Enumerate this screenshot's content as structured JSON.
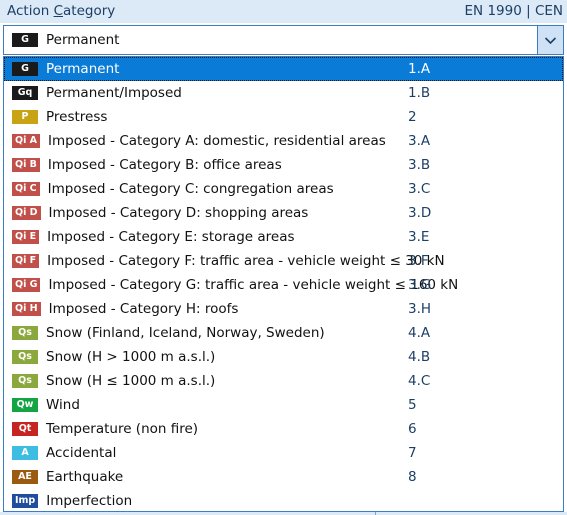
{
  "header": {
    "title_prefix": "Action ",
    "title_accel": "C",
    "title_suffix": "ategory",
    "standard": "EN 1990 | CEN"
  },
  "combo": {
    "selected_label": "Permanent",
    "selected_badge": "G",
    "selected_badge_color": "#1a1a1a",
    "arrow_icon": "chevron-down-icon"
  },
  "dropdown": {
    "options": [
      {
        "badge": "G",
        "badge_sub": "",
        "badge_color": "#1a1a1a",
        "label": "Permanent",
        "code": "1.A",
        "selected": true
      },
      {
        "badge": "G",
        "badge_sub": "q",
        "badge_color": "#1a1a1a",
        "label": "Permanent/Imposed",
        "code": "1.B",
        "selected": false
      },
      {
        "badge": "P",
        "badge_sub": "",
        "badge_color": "#c8a415",
        "label": "Prestress",
        "code": "2",
        "selected": false
      },
      {
        "badge": "Qi",
        "badge_sub": " A",
        "badge_color": "#c1504a",
        "label": "Imposed - Category A: domestic, residential areas",
        "code": "3.A",
        "selected": false
      },
      {
        "badge": "Qi",
        "badge_sub": " B",
        "badge_color": "#c1504a",
        "label": "Imposed - Category B: office areas",
        "code": "3.B",
        "selected": false
      },
      {
        "badge": "Qi",
        "badge_sub": " C",
        "badge_color": "#c1504a",
        "label": "Imposed - Category C: congregation areas",
        "code": "3.C",
        "selected": false
      },
      {
        "badge": "Qi",
        "badge_sub": " D",
        "badge_color": "#c1504a",
        "label": "Imposed - Category D: shopping areas",
        "code": "3.D",
        "selected": false
      },
      {
        "badge": "Qi",
        "badge_sub": " E",
        "badge_color": "#c1504a",
        "label": "Imposed - Category E: storage areas",
        "code": "3.E",
        "selected": false
      },
      {
        "badge": "Qi",
        "badge_sub": " F",
        "badge_color": "#c1504a",
        "label": "Imposed - Category F: traffic area - vehicle weight ≤ 30 kN",
        "code": "3.F",
        "selected": false
      },
      {
        "badge": "Qi",
        "badge_sub": " G",
        "badge_color": "#c1504a",
        "label": "Imposed - Category G: traffic area - vehicle weight ≤ 160 kN",
        "code": "3.G",
        "selected": false
      },
      {
        "badge": "Qi",
        "badge_sub": " H",
        "badge_color": "#c1504a",
        "label": "Imposed - Category H: roofs",
        "code": "3.H",
        "selected": false
      },
      {
        "badge": "Qs",
        "badge_sub": "",
        "badge_color": "#8aa83c",
        "label": "Snow (Finland, Iceland, Norway, Sweden)",
        "code": "4.A",
        "selected": false
      },
      {
        "badge": "Qs",
        "badge_sub": "",
        "badge_color": "#8aa83c",
        "label": "Snow (H > 1000 m a.s.l.)",
        "code": "4.B",
        "selected": false
      },
      {
        "badge": "Qs",
        "badge_sub": "",
        "badge_color": "#8aa83c",
        "label": "Snow (H ≤ 1000 m a.s.l.)",
        "code": "4.C",
        "selected": false
      },
      {
        "badge": "Qw",
        "badge_sub": "",
        "badge_color": "#13a544",
        "label": "Wind",
        "code": "5",
        "selected": false
      },
      {
        "badge": "Qt",
        "badge_sub": "",
        "badge_color": "#c62423",
        "label": "Temperature (non fire)",
        "code": "6",
        "selected": false
      },
      {
        "badge": "A",
        "badge_sub": "",
        "badge_color": "#3ebde2",
        "label": "Accidental",
        "code": "7",
        "selected": false
      },
      {
        "badge": "AE",
        "badge_sub": "",
        "badge_color": "#9a5a12",
        "label": "Earthquake",
        "code": "8",
        "selected": false
      },
      {
        "badge": "Imp",
        "badge_sub": "",
        "badge_color": "#1f4e9c",
        "label": "Imperfection",
        "code": "",
        "selected": false
      }
    ]
  },
  "colors": {
    "header_bg": "#dce9f7",
    "header_text": "#1d3f66",
    "selection_bg": "#0a7bd6",
    "border": "#3c7cc0"
  }
}
